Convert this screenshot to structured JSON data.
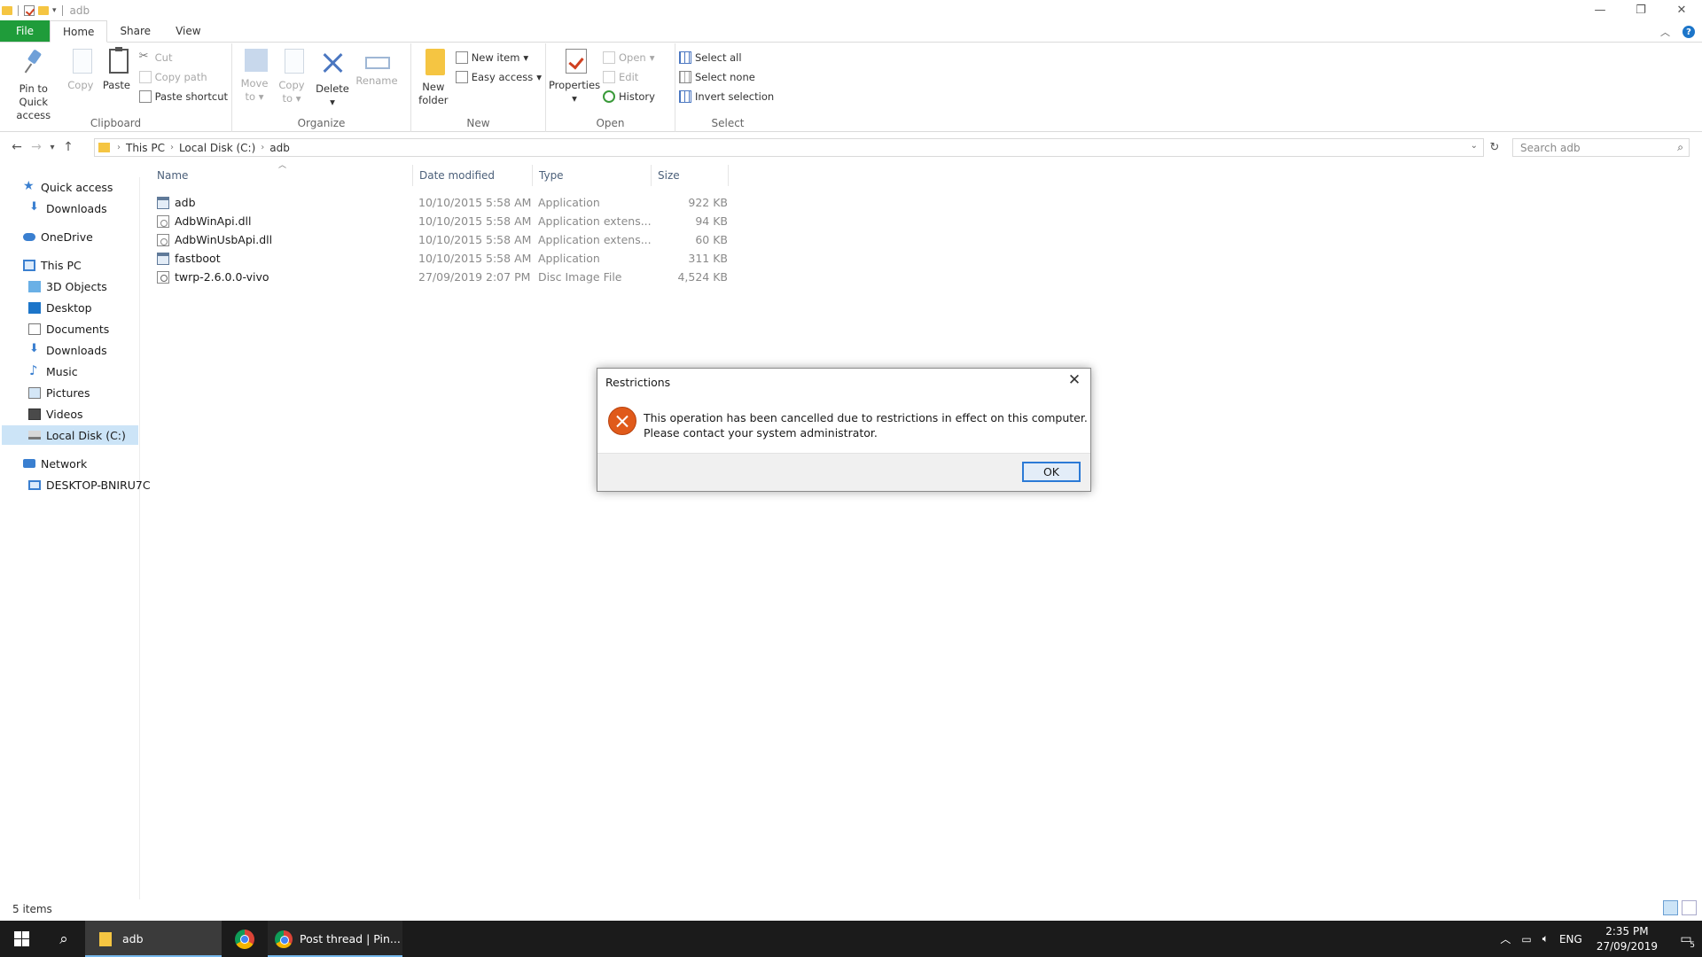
{
  "window": {
    "title": "adb",
    "minimize": "—",
    "restore": "❐",
    "close": "✕"
  },
  "tabs": [
    {
      "label": "File"
    },
    {
      "label": "Home"
    },
    {
      "label": "Share"
    },
    {
      "label": "View"
    }
  ],
  "ribbon": {
    "clipboard": {
      "pin_label_1": "Pin to Quick",
      "pin_label_2": "access",
      "copy_label": "Copy",
      "paste_label": "Paste",
      "cut_label": "Cut",
      "copy_path_label": "Copy path",
      "paste_shortcut_label": "Paste shortcut",
      "group_label": "Clipboard"
    },
    "organize": {
      "move_label_1": "Move",
      "move_label_2": "to",
      "copy_label_1": "Copy",
      "copy_label_2": "to",
      "delete_label": "Delete",
      "rename_label": "Rename",
      "group_label": "Organize"
    },
    "new": {
      "new_folder_label_1": "New",
      "new_folder_label_2": "folder",
      "new_item_label": "New item",
      "easy_access_label": "Easy access",
      "group_label": "New"
    },
    "open": {
      "properties_label": "Properties",
      "open_label": "Open",
      "edit_label": "Edit",
      "history_label": "History",
      "group_label": "Open"
    },
    "select": {
      "select_all_label": "Select all",
      "select_none_label": "Select none",
      "invert_label": "Invert selection",
      "group_label": "Select"
    }
  },
  "address": {
    "crumbs": [
      "This PC",
      "Local Disk (C:)",
      "adb"
    ],
    "search_placeholder": "Search adb"
  },
  "nav": {
    "quick_access": "Quick access",
    "downloads_qa": "Downloads",
    "onedrive": "OneDrive",
    "this_pc": "This PC",
    "objects3d": "3D Objects",
    "desktop": "Desktop",
    "documents": "Documents",
    "downloads": "Downloads",
    "music": "Music",
    "pictures": "Pictures",
    "videos": "Videos",
    "local_disk": "Local Disk (C:)",
    "network": "Network",
    "host": "DESKTOP-BNIRU7C"
  },
  "files": {
    "columns": [
      "Name",
      "Date modified",
      "Type",
      "Size"
    ],
    "rows": [
      {
        "name": "adb",
        "date": "10/10/2015 5:58 AM",
        "type": "Application",
        "size": "922 KB",
        "icon": "app-icon"
      },
      {
        "name": "AdbWinApi.dll",
        "date": "10/10/2015 5:58 AM",
        "type": "Application extens...",
        "size": "94 KB",
        "icon": "dll-icon"
      },
      {
        "name": "AdbWinUsbApi.dll",
        "date": "10/10/2015 5:58 AM",
        "type": "Application extens...",
        "size": "60 KB",
        "icon": "dll-icon"
      },
      {
        "name": "fastboot",
        "date": "10/10/2015 5:58 AM",
        "type": "Application",
        "size": "311 KB",
        "icon": "app-icon"
      },
      {
        "name": "twrp-2.6.0.0-vivo",
        "date": "27/09/2019 2:07 PM",
        "type": "Disc Image File",
        "size": "4,524 KB",
        "icon": "disc-image-icon"
      }
    ]
  },
  "status": {
    "items_count": "5 items"
  },
  "dialog": {
    "title": "Restrictions",
    "message_line1": "This operation has been cancelled due to restrictions in effect on this computer.",
    "message_line2": "Please contact your system administrator.",
    "ok_label": "OK"
  },
  "taskbar": {
    "explorer_label": "adb",
    "thread_label": "Post thread | Pin...",
    "language": "ENG",
    "time": "2:35 PM",
    "date": "27/09/2019",
    "notification_count": "5"
  }
}
